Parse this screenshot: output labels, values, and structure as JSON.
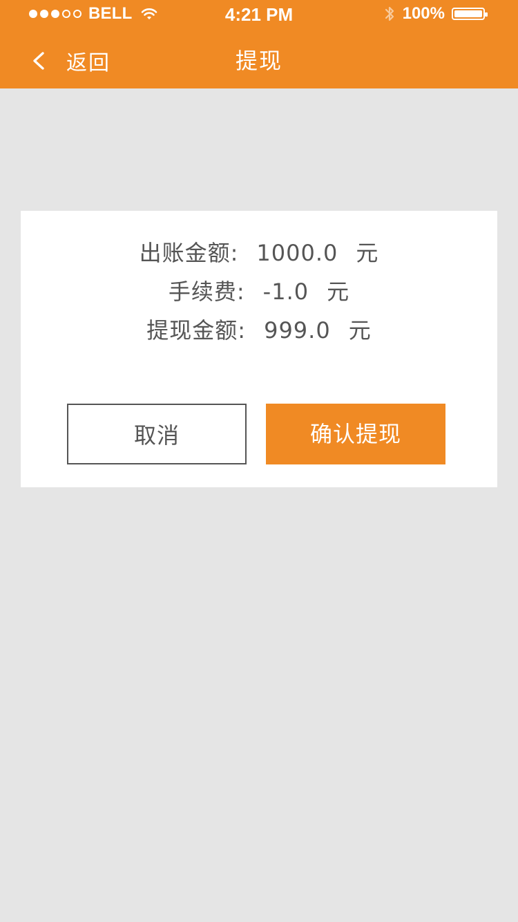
{
  "status_bar": {
    "carrier": "BELL",
    "time": "4:21 PM",
    "battery": "100%",
    "icons": [
      "signal-dots",
      "wifi-icon",
      "bluetooth-icon",
      "battery-icon"
    ]
  },
  "header": {
    "back_label": "返回",
    "title": "提现",
    "background": "#f08a24"
  },
  "summary": {
    "rows": [
      {
        "label": "出账金额:",
        "value": "1000.0",
        "unit": "元"
      },
      {
        "label": "手续费:",
        "value": "-1.0",
        "unit": "元"
      },
      {
        "label": "提现金额:",
        "value": "999.0",
        "unit": "元"
      }
    ]
  },
  "actions": {
    "cancel_label": "取消",
    "confirm_label": "确认提现",
    "accent": "#f08a24"
  }
}
